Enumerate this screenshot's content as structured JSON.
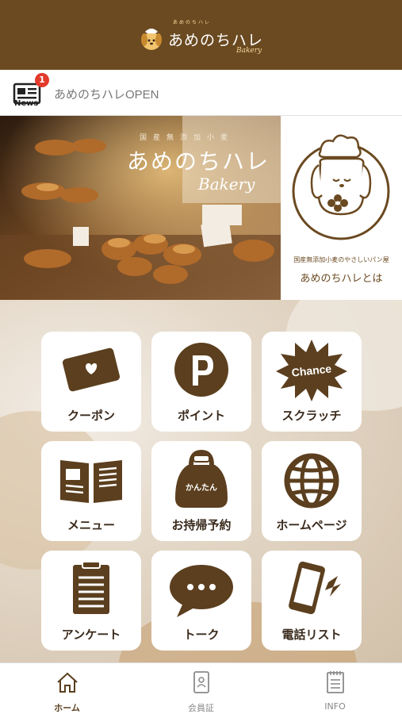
{
  "header": {
    "logo_text": "あめのちハレ",
    "logo_sub": "Bakery",
    "logo_kana": "あめのちハレ"
  },
  "news": {
    "icon_label": "News",
    "badge_count": "1",
    "headline": "あめのちハレOPEN"
  },
  "banner": {
    "title": "あめのちハレ",
    "kana": "国産無添加小麦",
    "script": "Bakery",
    "about_sub": "国産無添加小麦のやさしいパン屋",
    "about_title": "あめのちハレとは"
  },
  "menu": {
    "tiles": [
      {
        "label": "クーポン",
        "icon": "coupon-card-icon"
      },
      {
        "label": "ポイント",
        "icon": "point-p-icon"
      },
      {
        "label": "スクラッチ",
        "icon": "chance-scratch-icon",
        "icon_text": "Chance"
      },
      {
        "label": "メニュー",
        "icon": "open-book-icon"
      },
      {
        "label": "お持帰予約",
        "icon": "bag-icon",
        "icon_text": "かんたん"
      },
      {
        "label": "ホームページ",
        "icon": "globe-icon"
      },
      {
        "label": "アンケート",
        "icon": "clipboard-icon"
      },
      {
        "label": "トーク",
        "icon": "chat-bubble-icon"
      },
      {
        "label": "電話リスト",
        "icon": "phone-icon"
      }
    ]
  },
  "tabbar": {
    "tabs": [
      {
        "label": "ホーム",
        "icon": "home-icon",
        "active": true
      },
      {
        "label": "会員証",
        "icon": "member-card-icon",
        "active": false
      },
      {
        "label": "INFO",
        "icon": "info-doc-icon",
        "active": false
      }
    ]
  },
  "colors": {
    "brand_brown": "#6b4a21",
    "icon_brown": "#5b3f1e",
    "badge_red": "#e23a2b"
  }
}
